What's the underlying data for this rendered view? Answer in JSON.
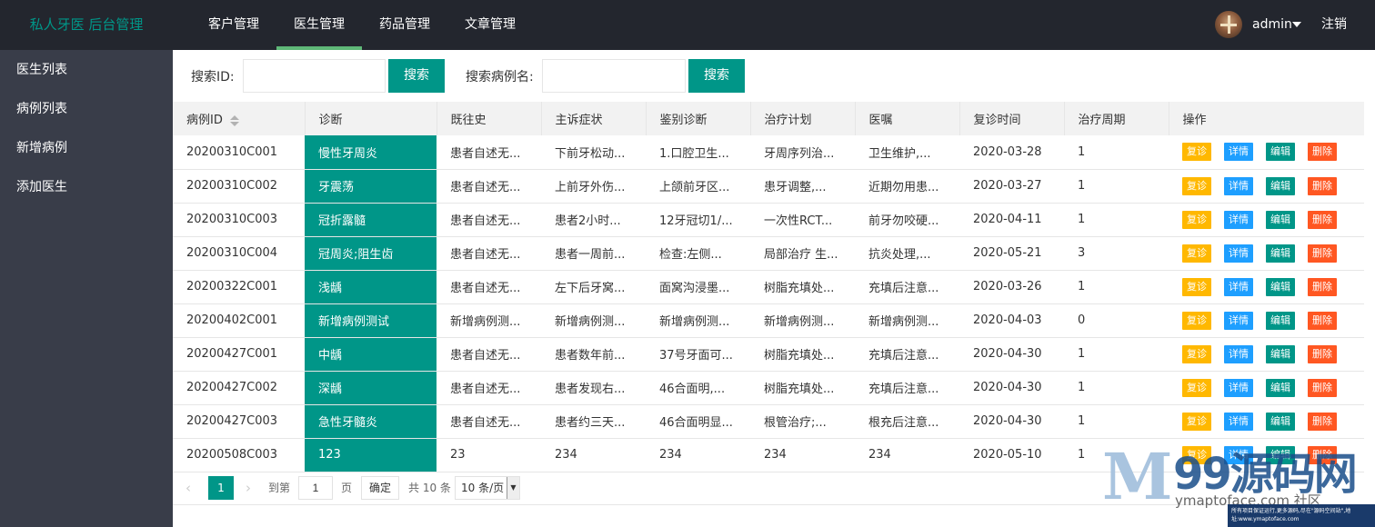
{
  "header": {
    "logo": "私人牙医 后台管理",
    "nav": [
      "客户管理",
      "医生管理",
      "药品管理",
      "文章管理"
    ],
    "active_nav": "医生管理",
    "username": "admin",
    "logout": "注销"
  },
  "sidebar": {
    "items": [
      "医生列表",
      "病例列表",
      "新增病例",
      "添加医生"
    ]
  },
  "search": {
    "id_label": "搜索ID:",
    "id_value": "",
    "btn1": "搜索",
    "name_label": "搜索病例名:",
    "name_value": "",
    "btn2": "搜索"
  },
  "table": {
    "columns": [
      "病例ID",
      "诊断",
      "既往史",
      "主诉症状",
      "鉴别诊断",
      "治疗计划",
      "医嘱",
      "复诊时间",
      "治疗周期",
      "操作"
    ],
    "rows": [
      [
        "20200310C001",
        "慢性牙周炎",
        "患者自述无...",
        "下前牙松动...",
        "1.口腔卫生...",
        "牙周序列治...",
        "卫生维护,...",
        "2020-03-28",
        "1"
      ],
      [
        "20200310C002",
        "牙震荡",
        "患者自述无...",
        "上前牙外伤...",
        "上颌前牙区...",
        "患牙调整,...",
        "近期勿用患...",
        "2020-03-27",
        "1"
      ],
      [
        "20200310C003",
        "冠折露髓",
        "患者自述无...",
        "患者2小时...",
        "12牙冠切1/...",
        "一次性RCT...",
        "前牙勿咬硬...",
        "2020-04-11",
        "1"
      ],
      [
        "20200310C004",
        "冠周炎;阻生齿",
        "患者自述无...",
        "患者一周前...",
        "检查:左侧...",
        "局部治疗 生...",
        "抗炎处理,...",
        "2020-05-21",
        "3"
      ],
      [
        "20200322C001",
        "浅龋",
        "患者自述无...",
        "左下后牙窝...",
        "面窝沟浸墨...",
        "树脂充填处...",
        "充填后注意...",
        "2020-03-26",
        "1"
      ],
      [
        "20200402C001",
        "新增病例测试",
        "新增病例测...",
        "新增病例测...",
        "新增病例测...",
        "新增病例测...",
        "新增病例测...",
        "2020-04-03",
        "0"
      ],
      [
        "20200427C001",
        "中龋",
        "患者自述无...",
        "患者数年前...",
        "37号牙面可...",
        "树脂充填处...",
        "充填后注意...",
        "2020-04-30",
        "1"
      ],
      [
        "20200427C002",
        "深龋",
        "患者自述无...",
        "患者发现右...",
        "46合面明,...",
        "树脂充填处...",
        "充填后注意...",
        "2020-04-30",
        "1"
      ],
      [
        "20200427C003",
        "急性牙髓炎",
        "患者自述无...",
        "患者约三天...",
        "46合面明显...",
        "根管治疗;...",
        "根充后注意...",
        "2020-04-30",
        "1"
      ],
      [
        "20200508C003",
        "123",
        "23",
        "234",
        "234",
        "234",
        "234",
        "2020-05-10",
        "1"
      ]
    ],
    "actions": [
      "复诊",
      "详情",
      "编辑",
      "删除"
    ]
  },
  "pager": {
    "current": "1",
    "goto_label": "到第",
    "goto_value": "1",
    "page_label": "页",
    "confirm": "确定",
    "total": "共 10 条",
    "per_page": "10 条/页"
  },
  "watermark": {
    "brand": "99源码网",
    "site": "ymaptoface.com 社区",
    "note": "所有项目保证运行,更多源码,尽在\"源码空间站\",地址:www.ymaptoface.com"
  },
  "colors": {
    "topbar": "#23262e",
    "sidebar": "#393d49",
    "accent": "#009688",
    "nav_underline": "#5fb878",
    "btn_revisit": "#ffb800",
    "btn_detail": "#1e9fff",
    "btn_edit": "#009688",
    "btn_delete": "#ff5722"
  }
}
